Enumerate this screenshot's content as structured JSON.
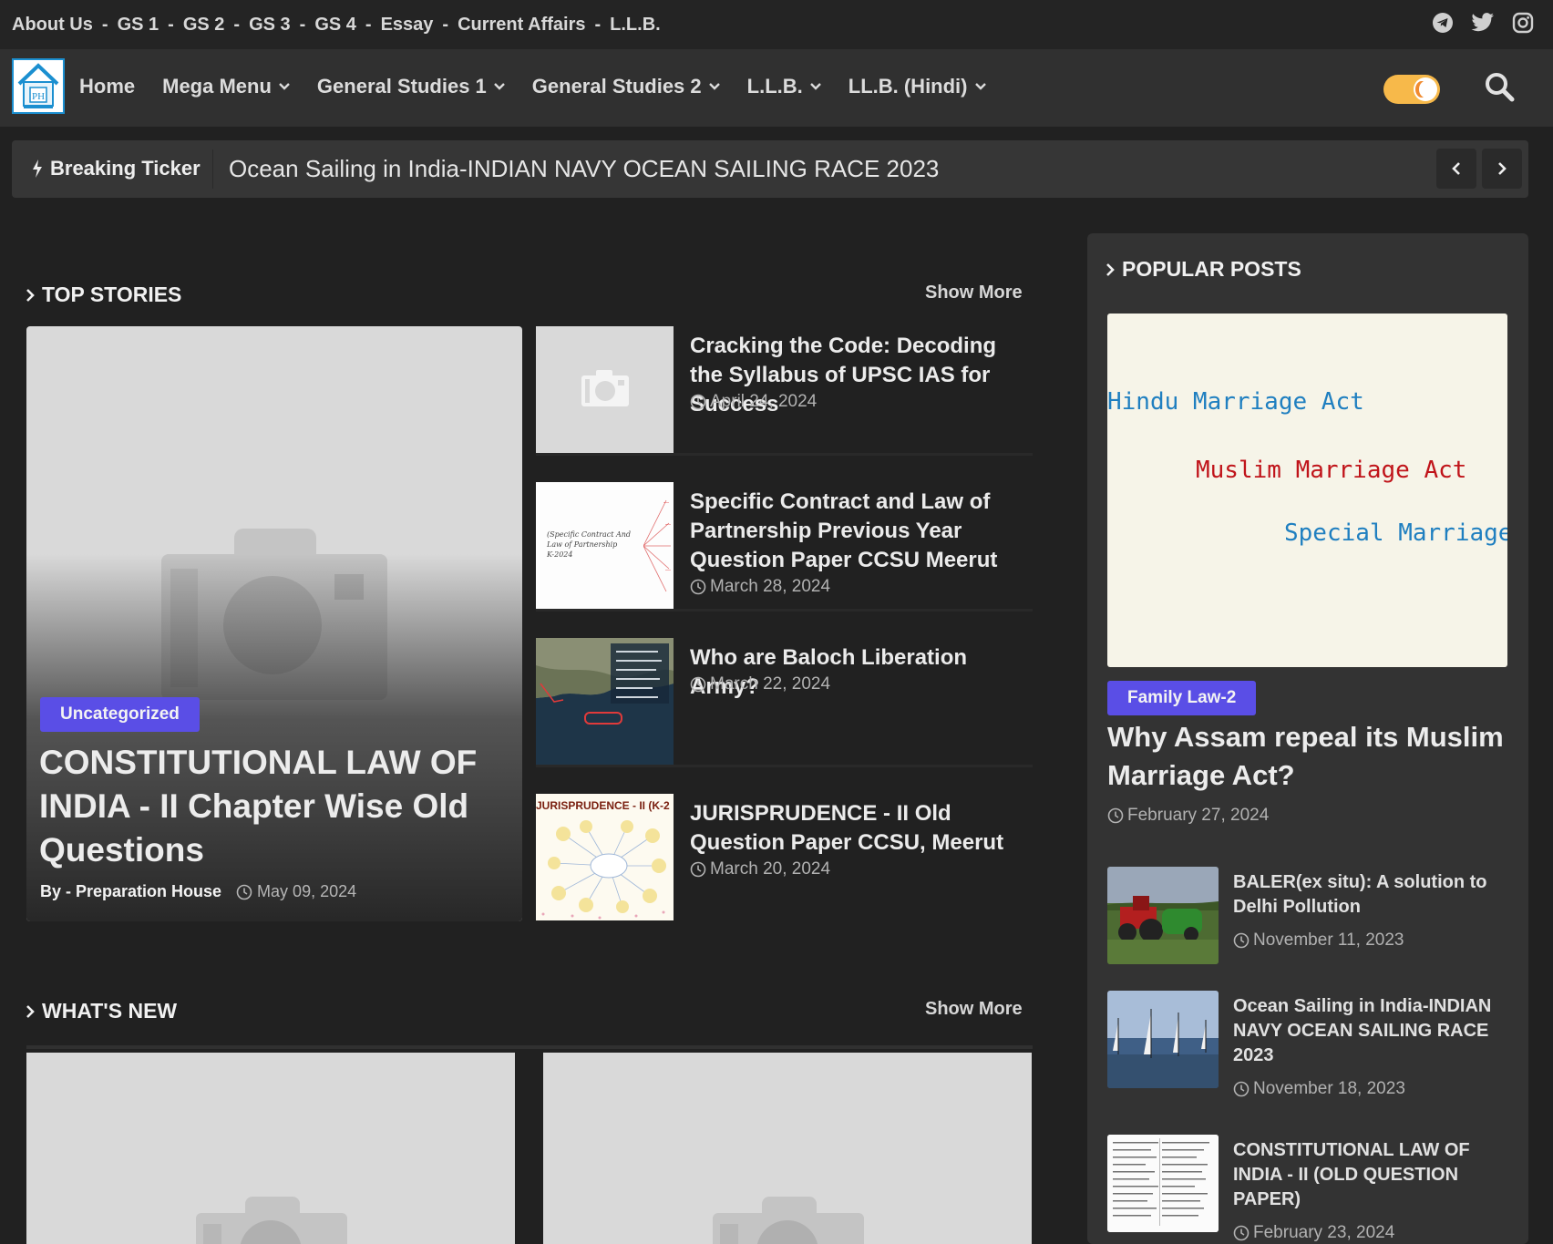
{
  "topbar": {
    "links": [
      "About Us",
      "GS 1",
      "GS 2",
      "GS 3",
      "GS 4",
      "Essay",
      "Current Affairs",
      "L.L.B."
    ],
    "separator": "-"
  },
  "nav": {
    "logo_alt": "PH",
    "items": [
      {
        "label": "Home",
        "has_dropdown": false
      },
      {
        "label": "Mega Menu",
        "has_dropdown": true
      },
      {
        "label": "General Studies 1",
        "has_dropdown": true
      },
      {
        "label": "General Studies 2",
        "has_dropdown": true
      },
      {
        "label": "L.L.B.",
        "has_dropdown": true
      },
      {
        "label": "LL.B. (Hindi)",
        "has_dropdown": true
      }
    ],
    "dark_mode_icon": "moon-toggle-icon",
    "search_icon": "search-icon"
  },
  "ticker": {
    "label": "Breaking Ticker",
    "text": "Ocean Sailing in India-INDIAN NAVY OCEAN SAILING RACE 2023"
  },
  "top_stories": {
    "heading": "TOP STORIES",
    "show_more": "Show More",
    "featured": {
      "badge": "Uncategorized",
      "title": "CONSTITUTIONAL LAW OF INDIA - II Chapter Wise Old Questions",
      "by_label": "By - Preparation House",
      "date": "May 09, 2024"
    },
    "items": [
      {
        "title": "Cracking the Code: Decoding the Syllabus of UPSC IAS for Success",
        "date": "April 24, 2024"
      },
      {
        "title": "Specific Contract and Law of Partnership Previous Year Question Paper CCSU Meerut",
        "date": "March 28, 2024"
      },
      {
        "title": "Who are Baloch Liberation Army?",
        "date": "March 22, 2024"
      },
      {
        "title": "JURISPRUDENCE - II Old Question Paper CCSU, Meerut",
        "date": "March 20, 2024"
      }
    ],
    "thumb_texts": {
      "contract_line1": "(Specific Contract And",
      "contract_line2": "Law of Partnership",
      "contract_line3": "K-2024",
      "juris_banner": "JURISPRUDENCE - II (K-2"
    }
  },
  "whats_new": {
    "heading": "WHAT'S NEW",
    "show_more": "Show More"
  },
  "popular": {
    "heading": "POPULAR POSTS",
    "image_text": {
      "line1": "Hindu Marriage Act",
      "line2": "Muslim Marriage Act",
      "line3": "Special Marriage A"
    },
    "featured": {
      "badge": "Family Law-2",
      "title": "Why Assam repeal its Muslim Marriage Act?",
      "date": "February 27, 2024"
    },
    "items": [
      {
        "title": "BALER(ex situ): A solution to Delhi Pollution",
        "date": "November 11, 2023"
      },
      {
        "title": "Ocean Sailing in India-INDIAN NAVY OCEAN SAILING RACE 2023",
        "date": "November 18, 2023"
      },
      {
        "title": "CONSTITUTIONAL LAW OF INDIA - II (OLD QUESTION PAPER)",
        "date": "February 23, 2024"
      }
    ]
  },
  "colors": {
    "background": "#212121",
    "badge": "#5a4ee6",
    "toggle": "#f7b94a",
    "hindu_text": "#1f7fc0",
    "muslim_text": "#c0141a",
    "special_text": "#1f7fc0"
  }
}
